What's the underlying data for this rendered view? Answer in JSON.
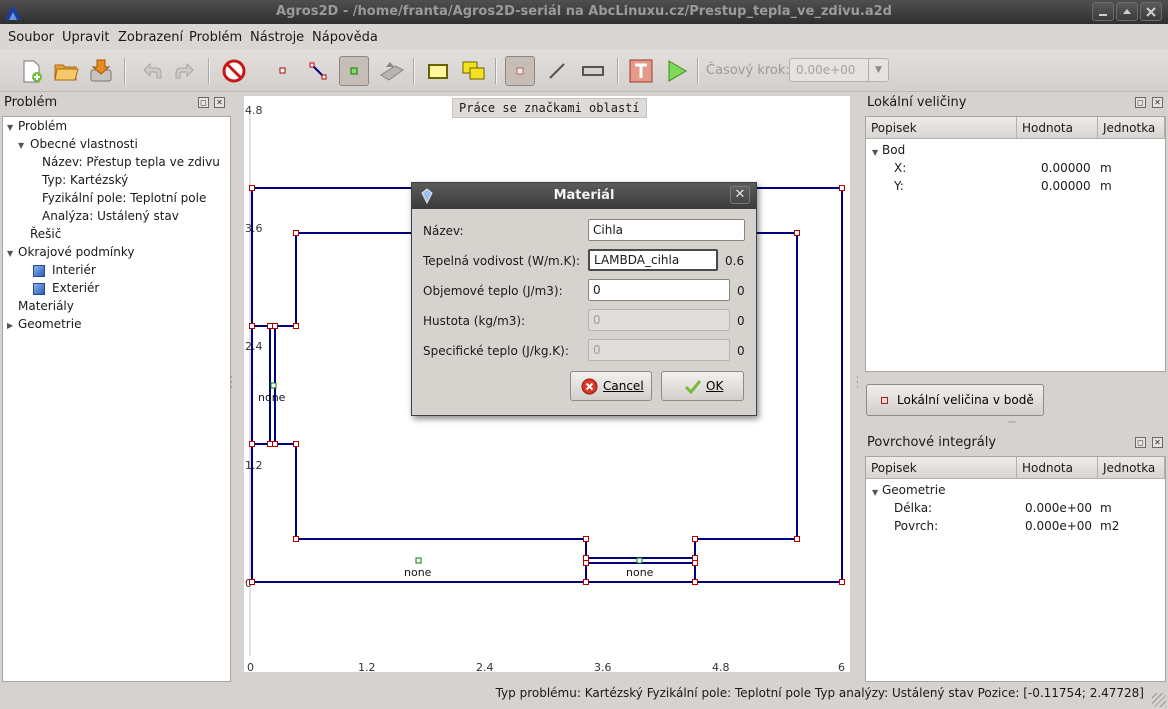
{
  "window": {
    "title": "Agros2D - /home/franta/Agros2D-seriál na AbcLinuxu.cz/Prestup_tepla_ve_zdivu.a2d"
  },
  "menu": [
    "Soubor",
    "Upravit",
    "Zobrazení",
    "Problém",
    "Nástroje",
    "Nápověda"
  ],
  "toolbar": {
    "buttons": [
      "new-file-icon",
      "open-folder-icon",
      "save-icon",
      "undo-icon",
      "redo-icon",
      "stop-icon",
      "node-icon",
      "edge-icon",
      "label-icon",
      "move-icon",
      "rectangle-icon",
      "copy-icon",
      "mesh-node-icon",
      "line-icon",
      "box-icon",
      "text-icon",
      "run-icon"
    ],
    "time_step_label": "Časový krok:",
    "time_step_value": "0.00e+00"
  },
  "problem_panel": {
    "title": "Problém",
    "tree": [
      {
        "label": "Problém",
        "level": 0,
        "expanded": true
      },
      {
        "label": "Obecné vlastnosti",
        "level": 1,
        "expanded": true
      },
      {
        "label": "Název: Přestup tepla ve zdivu",
        "level": 2
      },
      {
        "label": "Typ: Kartézský",
        "level": 2
      },
      {
        "label": "Fyzikální pole: Teplotní pole",
        "level": 2
      },
      {
        "label": "Analýza: Ustálený stav",
        "level": 2
      },
      {
        "label": "Řešič",
        "level": 1
      },
      {
        "label": "Okrajové podmínky",
        "level": 0,
        "expanded": true
      },
      {
        "label": "Interiér",
        "level": 2,
        "icon": "cube-icon"
      },
      {
        "label": "Exteriér",
        "level": 2,
        "icon": "cube-icon"
      },
      {
        "label": "Materiály",
        "level": 0
      },
      {
        "label": "Geometrie",
        "level": 0,
        "expanded": false
      }
    ]
  },
  "canvas": {
    "mode_label": "Práce se značkami oblastí",
    "x_axis_ticks": [
      "0",
      "1.2",
      "2.4",
      "3.6",
      "4.8",
      "6"
    ],
    "y_axis_ticks": [
      "4.8",
      "3.6",
      "2.4",
      "1.2",
      "0"
    ],
    "region_labels": [
      "none",
      "none",
      "none"
    ],
    "colors": {
      "edge": "#00007f",
      "node": "#b40000",
      "label_marker": "#007f00"
    }
  },
  "dialog": {
    "title": "Materiál",
    "fields": [
      {
        "label": "Název:",
        "value": "Cihla",
        "placeholder": "",
        "enabled": true,
        "evaluated": ""
      },
      {
        "label": "Tepelná vodivost (W/m.K):",
        "value": "LAMBDA_cihla",
        "placeholder": "",
        "enabled": true,
        "evaluated": "0.6"
      },
      {
        "label": "Objemové teplo (J/m3):",
        "value": "0",
        "placeholder": "",
        "enabled": true,
        "evaluated": "0"
      },
      {
        "label": "Hustota (kg/m3):",
        "value": "0",
        "placeholder": "",
        "enabled": false,
        "evaluated": "0"
      },
      {
        "label": "Specifické teplo (J/kg.K):",
        "value": "0",
        "placeholder": "",
        "enabled": false,
        "evaluated": "0"
      }
    ],
    "cancel_label": "Cancel",
    "ok_label": "OK"
  },
  "local_panel": {
    "title": "Lokální veličiny",
    "columns": [
      "Popisek",
      "Hodnota",
      "Jednotka"
    ],
    "group": "Bod",
    "rows": [
      {
        "name": "X:",
        "value": "0.00000",
        "unit": "m"
      },
      {
        "name": "Y:",
        "value": "0.00000",
        "unit": "m"
      }
    ],
    "button_label": "Lokální veličina v bodě"
  },
  "surface_panel": {
    "title": "Povrchové integrály",
    "columns": [
      "Popisek",
      "Hodnota",
      "Jednotka"
    ],
    "group": "Geometrie",
    "rows": [
      {
        "name": "Délka:",
        "value": "0.000e+00",
        "unit": "m"
      },
      {
        "name": "Povrch:",
        "value": "0.000e+00",
        "unit": "m2"
      }
    ]
  },
  "status": {
    "text": "Typ problému: Kartézský  Fyzikální pole: Teplotní pole  Typ analýzy: Ustálený stav  Pozice: [-0.11754;  2.47728]"
  }
}
